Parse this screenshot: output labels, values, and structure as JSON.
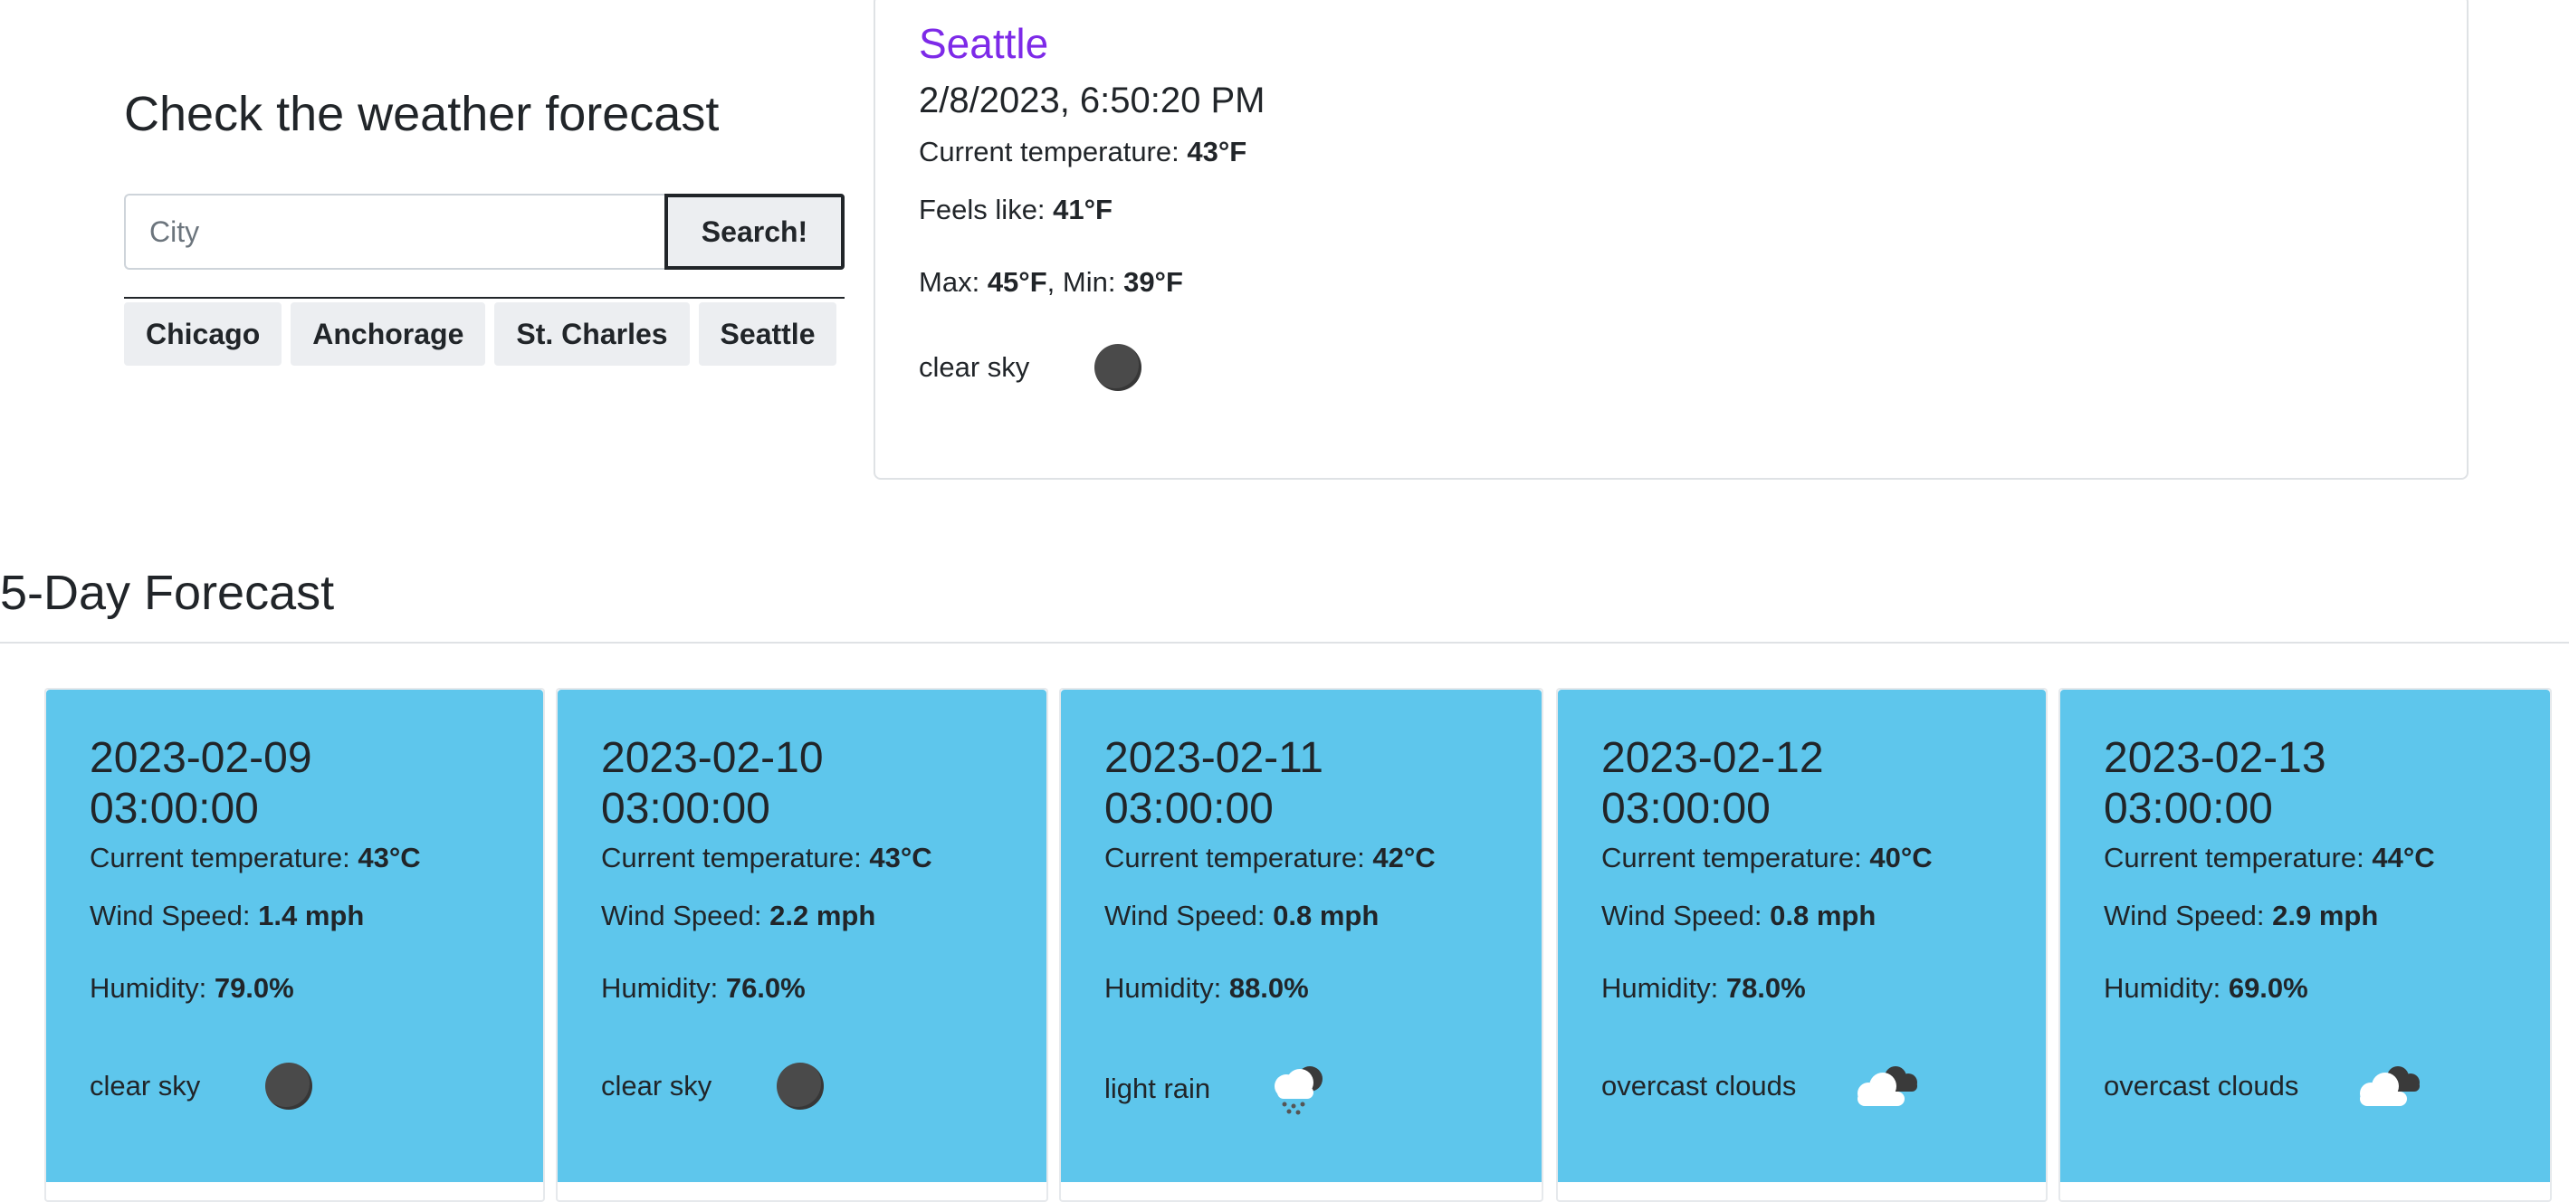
{
  "search": {
    "title": "Check the weather forecast",
    "placeholder": "City",
    "button_label": "Search!",
    "history": [
      "Chicago",
      "Anchorage",
      "St. Charles",
      "Seattle"
    ]
  },
  "current": {
    "city": "Seattle",
    "datetime": "2/8/2023, 6:50:20 PM",
    "temp_label": "Current temperature:",
    "temp_value": "43°F",
    "feels_label": "Feels like:",
    "feels_value": "41°F",
    "max_label": "Max:",
    "max_value": "45°F",
    "min_label": "Min:",
    "min_value": "39°F",
    "description": "clear sky",
    "icon": "clear-sky-night-icon"
  },
  "forecast": {
    "heading": "5-Day Forecast",
    "temp_label": "Current temperature:",
    "wind_label": "Wind Speed:",
    "humidity_label": "Humidity:",
    "days": [
      {
        "date": "2023-02-09",
        "time": "03:00:00",
        "temp": "43°C",
        "wind": "1.4 mph",
        "humidity": "79.0%",
        "description": "clear sky",
        "icon": "clear-sky-night-icon"
      },
      {
        "date": "2023-02-10",
        "time": "03:00:00",
        "temp": "43°C",
        "wind": "2.2 mph",
        "humidity": "76.0%",
        "description": "clear sky",
        "icon": "clear-sky-night-icon"
      },
      {
        "date": "2023-02-11",
        "time": "03:00:00",
        "temp": "42°C",
        "wind": "0.8 mph",
        "humidity": "88.0%",
        "description": "light rain",
        "icon": "light-rain-icon"
      },
      {
        "date": "2023-02-12",
        "time": "03:00:00",
        "temp": "40°C",
        "wind": "0.8 mph",
        "humidity": "78.0%",
        "description": "overcast clouds",
        "icon": "overcast-clouds-icon"
      },
      {
        "date": "2023-02-13",
        "time": "03:00:00",
        "temp": "44°C",
        "wind": "2.9 mph",
        "humidity": "69.0%",
        "description": "overcast clouds",
        "icon": "overcast-clouds-icon"
      }
    ]
  },
  "colors": {
    "city_name": "#7d2ae8",
    "forecast_card": "#5ec6ec",
    "button_bg": "#eceef1"
  }
}
